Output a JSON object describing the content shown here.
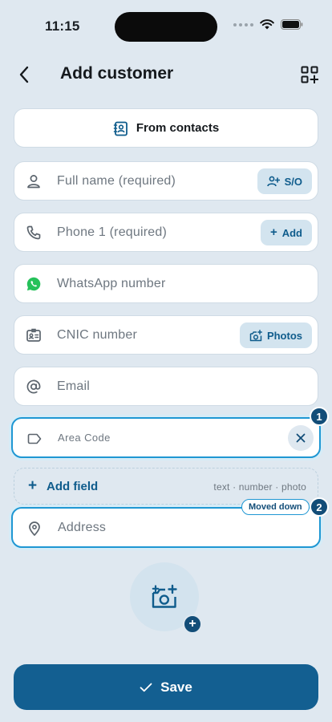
{
  "status_bar": {
    "time": "11:15"
  },
  "header": {
    "title": "Add customer"
  },
  "from_contacts": {
    "label": "From contacts"
  },
  "fields": {
    "full_name": {
      "placeholder": "Full name (required)",
      "chip": "S/O"
    },
    "phone": {
      "placeholder": "Phone 1 (required)",
      "chip": "Add"
    },
    "whatsapp": {
      "placeholder": "WhatsApp number"
    },
    "cnic": {
      "placeholder": "CNIC number",
      "chip": "Photos"
    },
    "email": {
      "placeholder": "Email"
    },
    "area_code": {
      "placeholder": "Area Code",
      "badge": "1"
    },
    "address": {
      "placeholder": "Address",
      "badge": "2",
      "tag": "Moved down"
    }
  },
  "add_field": {
    "label": "Add field",
    "hint": "text · number · photo"
  },
  "save": {
    "label": "Save"
  },
  "colors": {
    "accent": "#135f91",
    "highlight": "#1f97d3",
    "whatsapp": "#25c15a",
    "background": "#dfe8f0"
  },
  "icons": {
    "back": "chevron-left-icon",
    "qr": "qr-add-icon",
    "contacts": "contact-book-icon",
    "person": "person-icon",
    "phone": "phone-icon",
    "whatsapp": "whatsapp-icon",
    "id_card": "id-card-icon",
    "email": "at-icon",
    "tag": "tag-icon",
    "location": "location-pin-icon",
    "add_photo": "add-photo-icon",
    "check": "check-icon"
  }
}
